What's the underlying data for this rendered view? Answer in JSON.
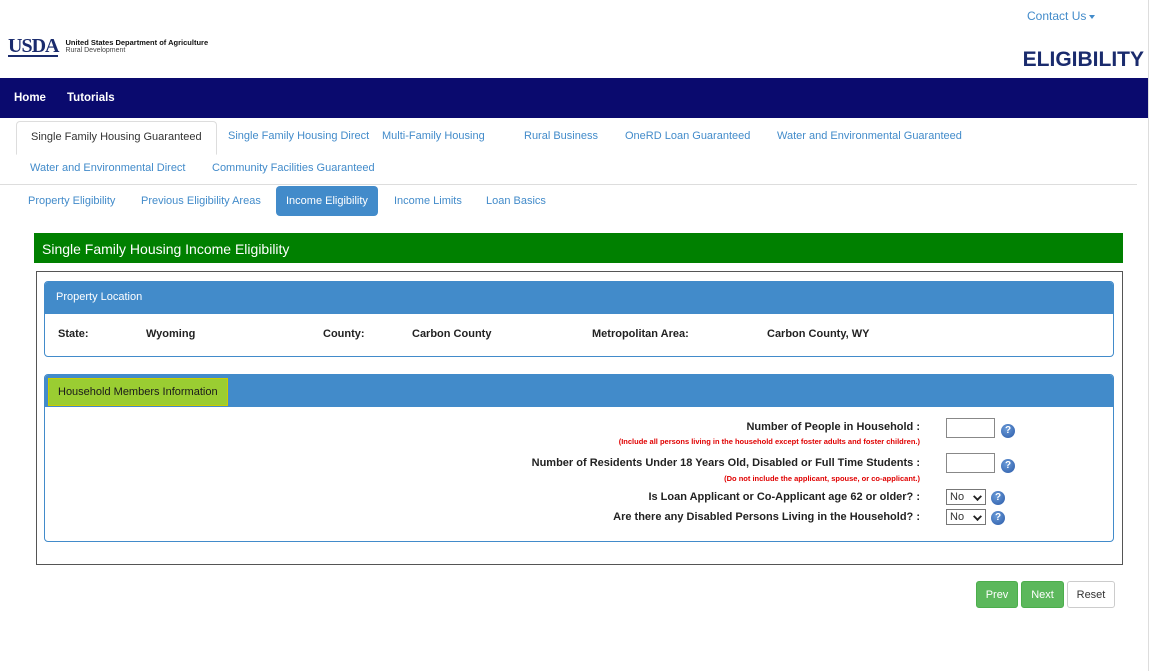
{
  "header": {
    "contact": "Contact Us",
    "logo_mark": "USDA",
    "agency_line1": "United States Department of Agriculture",
    "agency_line2": "Rural Development",
    "site_title": "ELIGIBILITY"
  },
  "navbar": {
    "items": [
      "Home",
      "Tutorials"
    ]
  },
  "program_tabs": [
    "Single Family Housing Guaranteed",
    "Single Family Housing Direct",
    "Multi-Family Housing",
    "Rural Business",
    "OneRD Loan Guaranteed",
    "Water and Environmental Guaranteed",
    "Water and Environmental Direct",
    "Community Facilities Guaranteed"
  ],
  "sub_tabs": [
    "Property Eligibility",
    "Previous Eligibility Areas",
    "Income Eligibility",
    "Income Limits",
    "Loan Basics"
  ],
  "page_title": "Single Family Housing Income Eligibility",
  "property": {
    "heading": "Property Location",
    "state_label": "State:",
    "state_value": "Wyoming",
    "county_label": "County:",
    "county_value": "Carbon County",
    "metro_label": "Metropolitan Area:",
    "metro_value": "Carbon County, WY"
  },
  "household": {
    "heading": "Household Members Information",
    "q1": "Number of People in Household :",
    "q1_note": "(Include all persons living in the household except foster adults and foster children.)",
    "q1_value": "",
    "q2": "Number of Residents Under 18 Years Old, Disabled or Full Time Students :",
    "q2_note": "(Do not include the applicant, spouse, or co-applicant.)",
    "q2_value": "",
    "q3": "Is Loan Applicant or Co-Applicant age 62 or older? :",
    "q3_value": "No",
    "q4": "Are there any Disabled Persons Living in the Household? :",
    "q4_value": "No",
    "help_glyph": "?"
  },
  "buttons": {
    "prev": "Prev",
    "next": "Next",
    "reset": "Reset"
  },
  "colors": {
    "navbar": "#0a0a6e",
    "title_bar": "#008000",
    "panel": "#428bca",
    "highlight": "#9acd32",
    "button": "#5cb85c"
  }
}
